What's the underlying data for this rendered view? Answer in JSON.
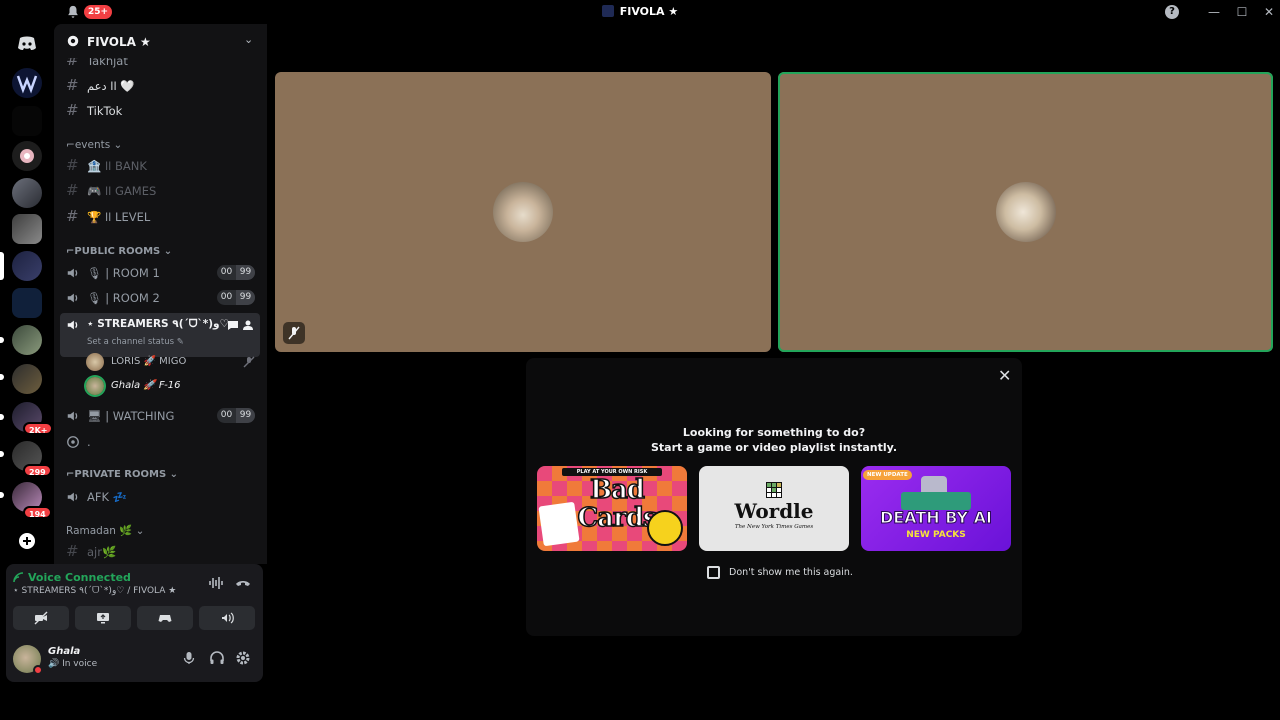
{
  "titlebar": {
    "notification_count": "25+",
    "server_title": "FIVOLA ★",
    "help_label": "?",
    "minimize": "—",
    "maximize": "☐",
    "close": "✕"
  },
  "rail": {
    "badges": [
      "2K+",
      "299",
      "194"
    ],
    "add_label": "+"
  },
  "sidebar": {
    "server_name": "FIVOLA ★",
    "channels_top": [
      {
        "label": "Takhjat",
        "icon": "hash-icon"
      },
      {
        "label": "اا دعم 🤍",
        "icon": "hash-icon"
      },
      {
        "label": "TikTok",
        "icon": "hash-icon"
      }
    ],
    "categories": {
      "events": "events",
      "public_rooms": "PUBLIC ROOMS",
      "private_rooms": "PRIVATE ROOMS",
      "ramadan": "Ramadan 🌿"
    },
    "events_channels": [
      "🏦 اا BANK",
      "🎮 اا GAMES",
      "🏆 اا LEVEL"
    ],
    "public_rooms": [
      {
        "label": "| ROOM 1",
        "count": "00",
        "limit": "99"
      },
      {
        "label": "| ROOM 2",
        "count": "00",
        "limit": "99"
      }
    ],
    "active_channel": {
      "label": "⋆ STREAMERS ٩(ˊᗜˋ*)و♡",
      "status": "Set a channel status ✎"
    },
    "voice_users": [
      {
        "name": "LORIS 🚀 MIGO"
      },
      {
        "name": "Ghala 🚀 F-16"
      }
    ],
    "watching": {
      "label": "| WATCHING",
      "count": "00",
      "limit": "99"
    },
    "stage_label": ".",
    "afk_label": "AFK 💤",
    "ramadan_channel": "ajr🌿"
  },
  "panel": {
    "voice_connected": "Voice Connected",
    "voice_location": "⋆ STREAMERS ٩(ˊᗜˋ*)و♡ / FIVOLA ★",
    "user_name": "Ghala",
    "user_status": "In voice"
  },
  "popover": {
    "close_label": "✕",
    "heading": "Looking for something to do?",
    "subheading": "Start a game or video playlist instantly.",
    "games": [
      {
        "title": "Bad Cards",
        "top_banner": "PLAY AT YOUR OWN RISK"
      },
      {
        "title": "Wordle",
        "subtitle": "The New York Times Games"
      },
      {
        "title": "DEATH BY AI",
        "tag": "NEW UPDATE",
        "footer": "NEW PACKS"
      }
    ],
    "dont_show": "Don't show me this again."
  },
  "colors": {
    "accent_green": "#23a55a",
    "danger": "#f23f43",
    "video_bg": "#8b7157"
  }
}
